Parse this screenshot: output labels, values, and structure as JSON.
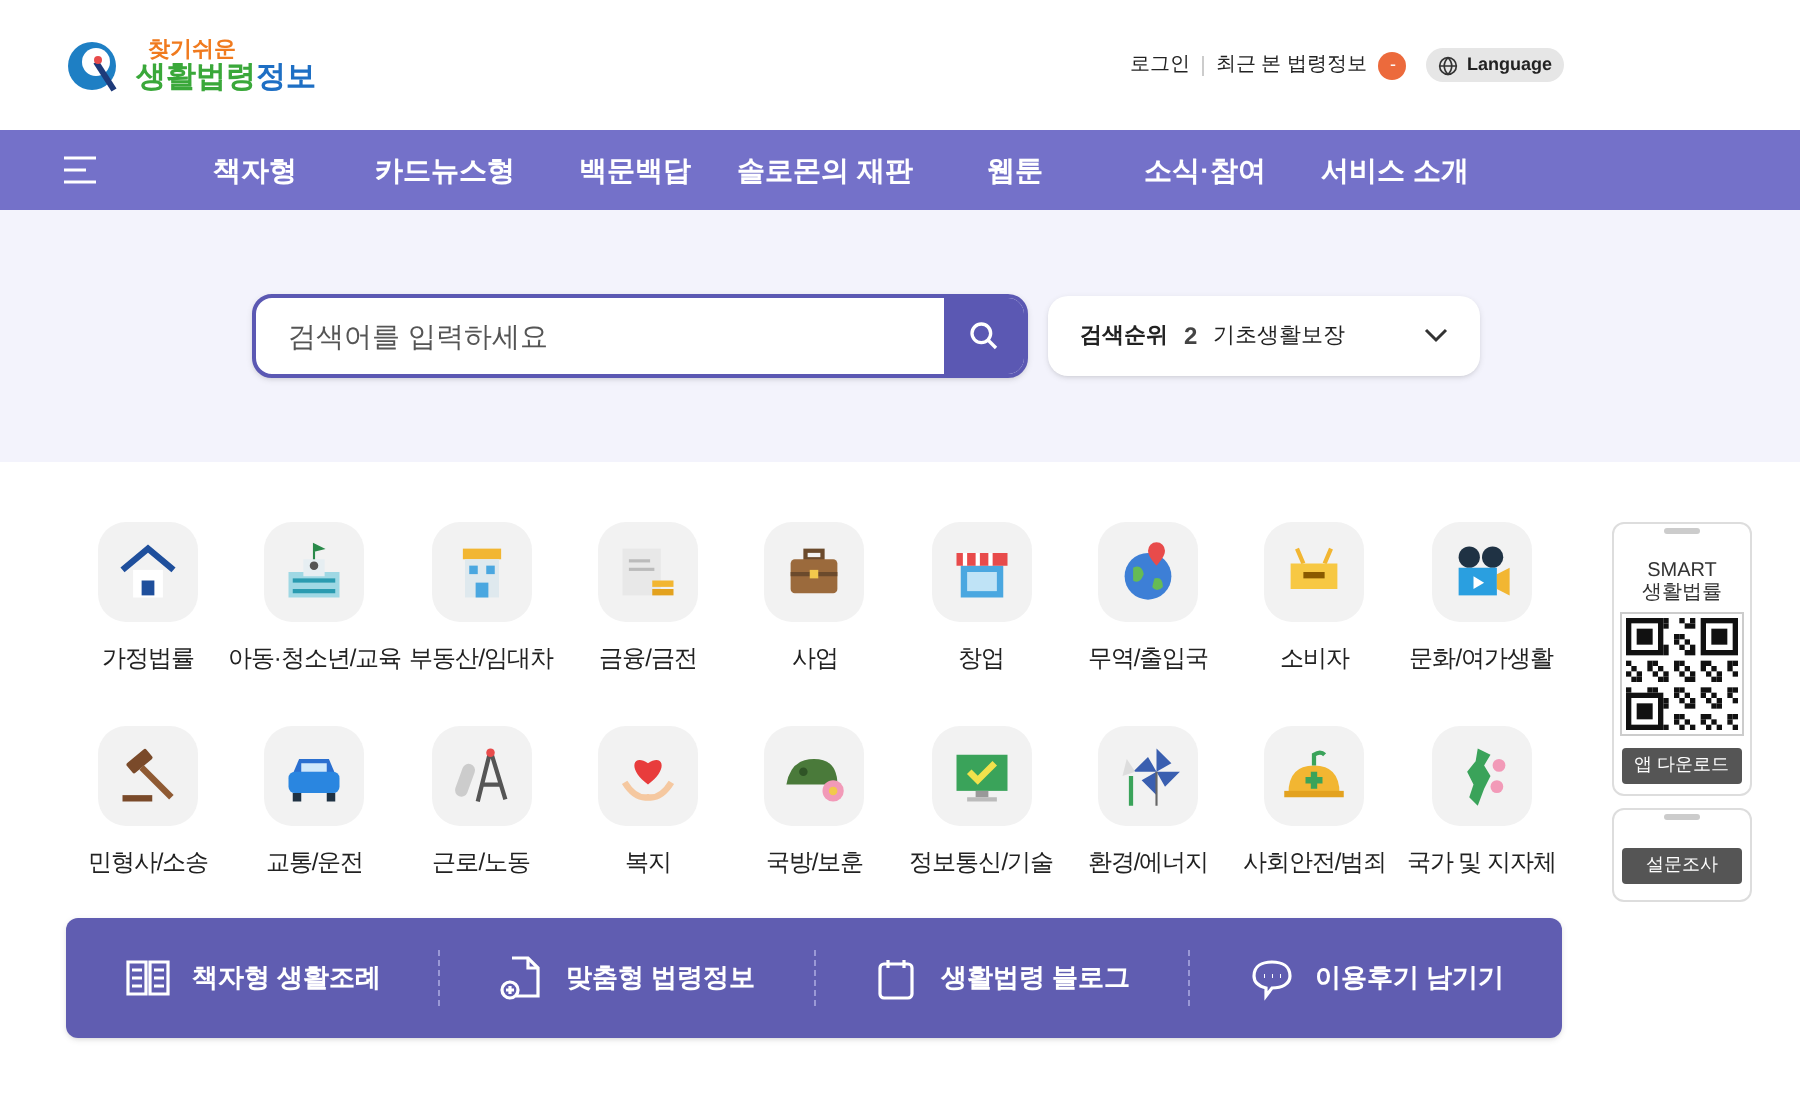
{
  "logo": {
    "tagline": "찾기쉬운",
    "name_main": "생활법령",
    "name_tail": "정보"
  },
  "header_links": {
    "login": "로그인",
    "recent": "최근 본 법령정보",
    "recent_count": "-",
    "language": "Language"
  },
  "nav": {
    "items": [
      {
        "label": "책자형"
      },
      {
        "label": "카드뉴스형"
      },
      {
        "label": "백문백답"
      },
      {
        "label": "솔로몬의 재판"
      },
      {
        "label": "웹툰"
      },
      {
        "label": "소식·참여"
      },
      {
        "label": "서비스 소개"
      }
    ]
  },
  "search": {
    "placeholder": "검색어를 입력하세요",
    "ranking_label": "검색순위",
    "ranking_number": "2",
    "ranking_term": "기초생활보장"
  },
  "categories": [
    {
      "label": "가정법률",
      "kind": "house"
    },
    {
      "label": "아동·청소년/교육",
      "kind": "school"
    },
    {
      "label": "부동산/임대차",
      "kind": "building"
    },
    {
      "label": "금융/금전",
      "kind": "money"
    },
    {
      "label": "사업",
      "kind": "briefcase"
    },
    {
      "label": "창업",
      "kind": "shop"
    },
    {
      "label": "무역/출입국",
      "kind": "globe"
    },
    {
      "label": "소비자",
      "kind": "sale"
    },
    {
      "label": "문화/여가생활",
      "kind": "camera"
    },
    {
      "label": "민형사/소송",
      "kind": "gavel"
    },
    {
      "label": "교통/운전",
      "kind": "car"
    },
    {
      "label": "근로/노동",
      "kind": "compass"
    },
    {
      "label": "복지",
      "kind": "heart"
    },
    {
      "label": "국방/보훈",
      "kind": "helmet"
    },
    {
      "label": "정보통신/기술",
      "kind": "monitor"
    },
    {
      "label": "환경/에너지",
      "kind": "pinwheel"
    },
    {
      "label": "사회안전/범죄",
      "kind": "hardhat"
    },
    {
      "label": "국가 및 지자체",
      "kind": "map"
    }
  ],
  "side_widgets": {
    "app_title_1": "SMART",
    "app_title_2": "생활법률",
    "app_button": "앱 다운로드",
    "survey_button": "설문조사"
  },
  "quick_links": [
    {
      "label": "책자형 생활조례",
      "kind": "book"
    },
    {
      "label": "맞춤형 법령정보",
      "kind": "document"
    },
    {
      "label": "생활법령 블로그",
      "kind": "notebook"
    },
    {
      "label": "이용후기 남기기",
      "kind": "chat"
    }
  ]
}
